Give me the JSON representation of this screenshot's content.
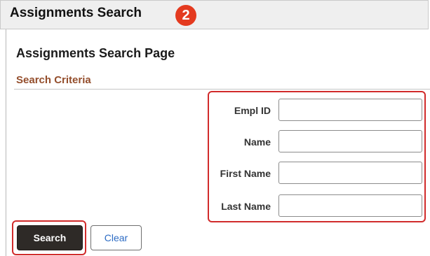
{
  "header": {
    "title": "Assignments Search",
    "step_badge": "2"
  },
  "page": {
    "title": "Assignments Search Page",
    "section_title": "Search Criteria"
  },
  "fields": [
    {
      "label": "Empl ID",
      "value": "",
      "placeholder": ""
    },
    {
      "label": "Name",
      "value": "",
      "placeholder": ""
    },
    {
      "label": "First Name",
      "value": "",
      "placeholder": ""
    },
    {
      "label": "Last Name",
      "value": "",
      "placeholder": ""
    }
  ],
  "actions": {
    "search_label": "Search",
    "clear_label": "Clear"
  },
  "colors": {
    "highlight": "#d12b2b",
    "badge": "#e43a1f",
    "section_title": "#944e2c",
    "search_button": "#2e2a27",
    "clear_text": "#2d6cc4"
  }
}
